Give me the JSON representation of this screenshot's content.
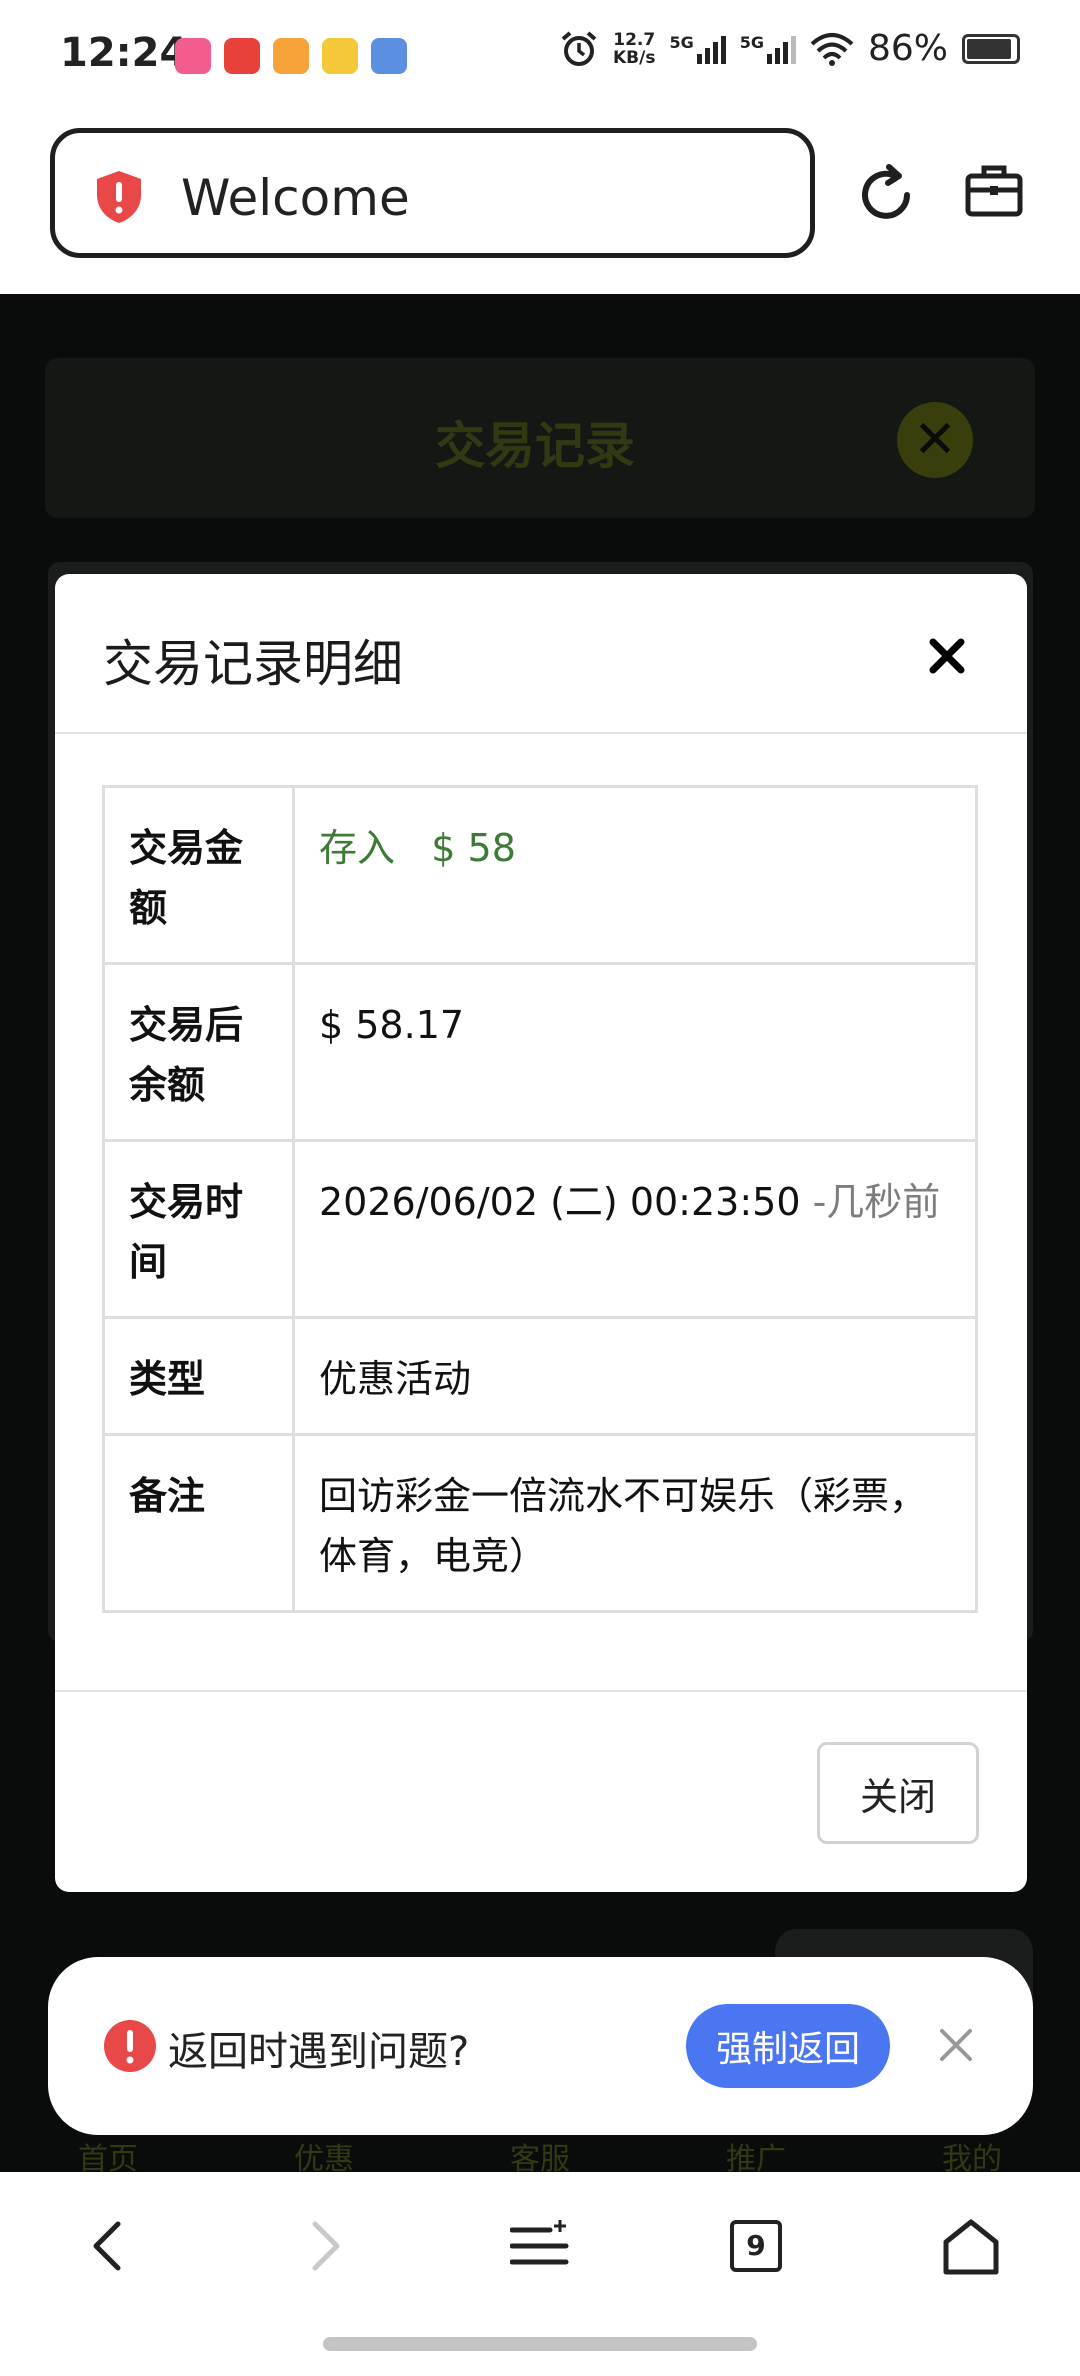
{
  "status_bar": {
    "time": "12:24",
    "app_icons": [
      "bilibili",
      "toutiao",
      "app3",
      "weibo",
      "game"
    ],
    "net_speed_value": "12.7",
    "net_speed_unit": "KB/s",
    "sim1": "5G",
    "sim2": "5G",
    "battery": "86%"
  },
  "browser": {
    "url_title": "Welcome"
  },
  "background_page": {
    "title": "交易记录",
    "nav_items": [
      "首页",
      "优惠",
      "客服",
      "推广",
      "我的"
    ]
  },
  "modal": {
    "title": "交易记录明细",
    "rows": [
      {
        "key": "交易金额",
        "value_prefix": "存入",
        "value": "$ 58"
      },
      {
        "key": "交易后余额",
        "value": "$ 58.17"
      },
      {
        "key": "交易时间",
        "value": "2026/06/02 (二) 00:23:50",
        "value_suffix": "-几秒前"
      },
      {
        "key": "类型",
        "value": "优惠活动"
      },
      {
        "key": "备注",
        "value": "回访彩金一倍流水不可娱乐（彩票，体育，电竞）"
      }
    ],
    "close_label": "关闭"
  },
  "toast": {
    "message": "返回时遇到问题?",
    "button_label": "强制返回"
  },
  "bottom_nav": {
    "tab_count": "9"
  },
  "colors": {
    "accent": "#4b76f2",
    "deposit_green": "#3d7a35",
    "warning_red": "#e04545"
  }
}
